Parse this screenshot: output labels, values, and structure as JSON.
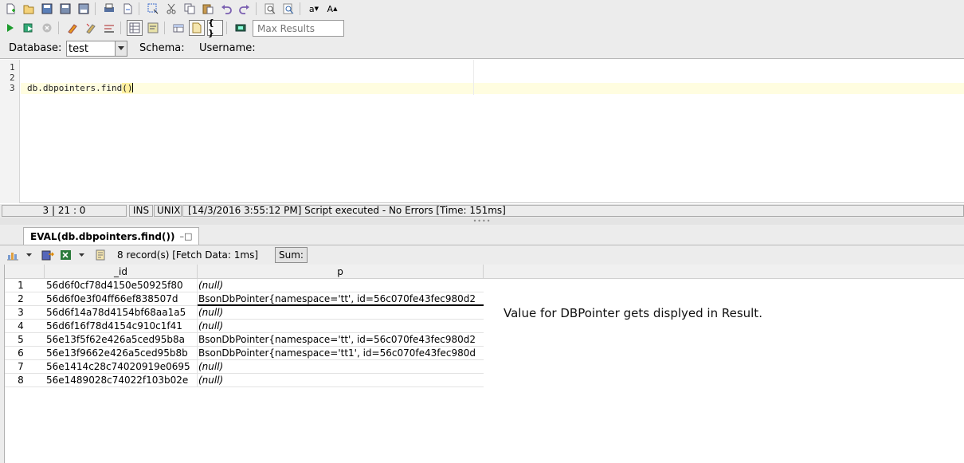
{
  "toolbar": {
    "max_results_placeholder": "Max Results",
    "icons_row1": [
      "new-file-icon",
      "open-folder-icon",
      "save-icon",
      "save-as-icon",
      "save-all-icon",
      "print-icon",
      "export-icon",
      "select-icon",
      "cut-icon",
      "copy-icon",
      "paste-icon",
      "undo-icon",
      "redo-icon",
      "find-icon",
      "replace-icon",
      "lowercase-icon",
      "uppercase-icon"
    ],
    "icons_row2": [
      "run-icon",
      "run-script-icon",
      "stop-icon",
      "explain-icon",
      "explain-options-icon",
      "format-icon",
      "results-grid-icon",
      "results-text-icon",
      "table-icon",
      "document-icon",
      "json-braces-icon",
      "record-icon",
      "search-results-icon"
    ],
    "lowercase_label": "a",
    "uppercase_label": "A",
    "json_label": "{ }"
  },
  "database": {
    "label": "Database:",
    "value": "test",
    "schema_label": "Schema:",
    "username_label": "Username:"
  },
  "editor": {
    "line_numbers": [
      "1",
      "2",
      "3"
    ],
    "code_prefix": "db.dbpointers.find",
    "code_paren": "()"
  },
  "status": {
    "position": "3 | 21 : 0",
    "mode": "INS",
    "line_ending": "UNIX",
    "message": "[14/3/2016 3:55:12 PM] Script executed - No Errors [Time: 151ms]"
  },
  "results": {
    "tab_label": "EVAL(db.dbpointers.find())",
    "records_text": "8 record(s) [Fetch Data: 1ms]",
    "sum_label": "Sum:",
    "columns": [
      "_id",
      "p"
    ],
    "rows": [
      {
        "n": "1",
        "id": "56d6f0cf78d4150e50925f80",
        "p": "(null)",
        "null": true
      },
      {
        "n": "2",
        "id": "56d6f0e3f04ff66ef838507d",
        "p": "BsonDbPointer{namespace='tt', id=56c070fe43fec980d2",
        "null": false
      },
      {
        "n": "3",
        "id": "56d6f14a78d4154bf68aa1a5",
        "p": "(null)",
        "null": true
      },
      {
        "n": "4",
        "id": "56d6f16f78d4154c910c1f41",
        "p": "(null)",
        "null": true
      },
      {
        "n": "5",
        "id": "56e13f5f62e426a5ced95b8a",
        "p": "BsonDbPointer{namespace='tt', id=56c070fe43fec980d2",
        "null": false
      },
      {
        "n": "6",
        "id": "56e13f9662e426a5ced95b8b",
        "p": "BsonDbPointer{namespace='tt1', id=56c070fe43fec980d",
        "null": false
      },
      {
        "n": "7",
        "id": "56e1414c28c74020919e0695",
        "p": "(null)",
        "null": true
      },
      {
        "n": "8",
        "id": "56e1489028c74022f103b02e",
        "p": "(null)",
        "null": true
      }
    ],
    "note": "Value for DBPointer gets displyed in Result."
  }
}
